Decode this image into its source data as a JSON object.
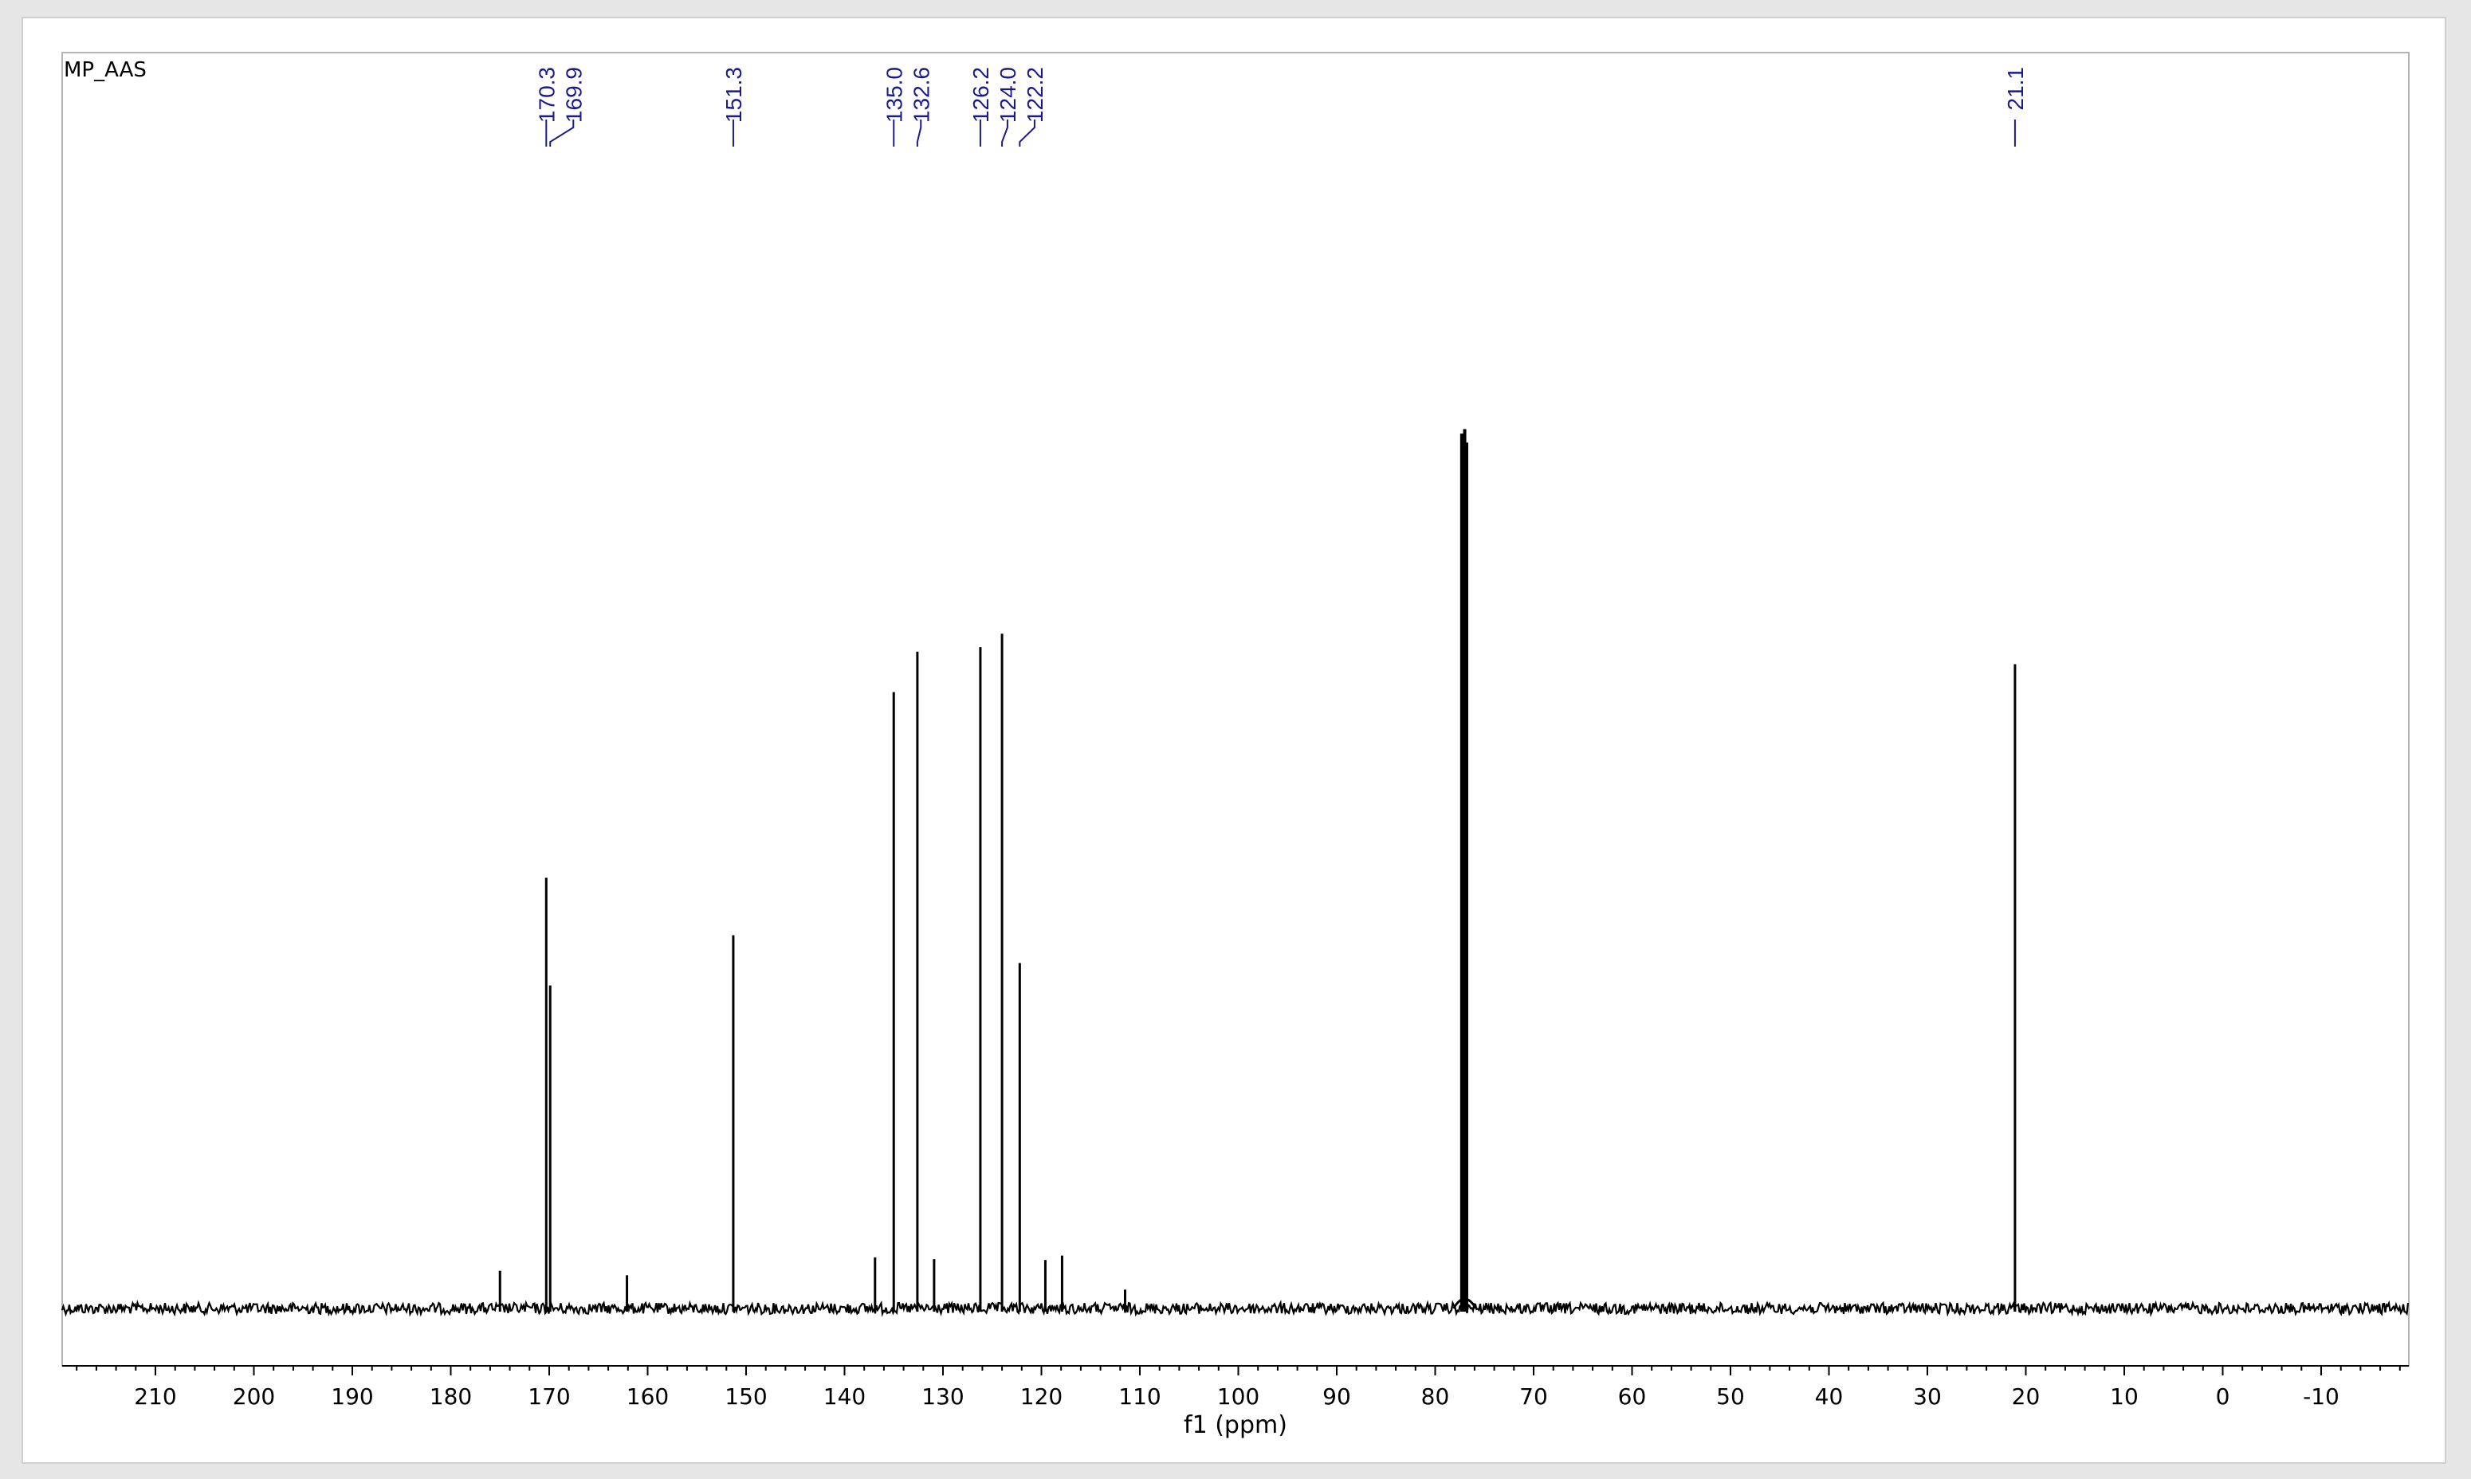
{
  "window": {
    "title": "MP_AAS"
  },
  "chart_data": {
    "type": "line",
    "title": "MP_AAS",
    "xlabel": "f1 (ppm)",
    "ylabel": "",
    "xlim": [
      220,
      -20
    ],
    "x_reversed": true,
    "ylim": [
      0,
      1.0
    ],
    "grid": false,
    "legend": "none",
    "x_ticks": [
      210,
      200,
      190,
      180,
      170,
      160,
      150,
      140,
      130,
      120,
      110,
      100,
      90,
      80,
      70,
      60,
      50,
      40,
      30,
      20,
      10,
      0,
      -10
    ],
    "x_tick_labels": [
      "210",
      "200",
      "190",
      "180",
      "170",
      "160",
      "150",
      "140",
      "130",
      "120",
      "110",
      "100",
      "90",
      "80",
      "70",
      "60",
      "50",
      "40",
      "30",
      "20",
      "10",
      "0",
      "-10"
    ],
    "line_color": "#000000",
    "label_color": "#1a1a8a",
    "peaks": [
      {
        "ppm": 175.0,
        "intensity": 0.042
      },
      {
        "ppm": 170.3,
        "intensity": 0.48
      },
      {
        "ppm": 169.9,
        "intensity": 0.36
      },
      {
        "ppm": 162.1,
        "intensity": 0.037
      },
      {
        "ppm": 151.3,
        "intensity": 0.416
      },
      {
        "ppm": 136.9,
        "intensity": 0.057
      },
      {
        "ppm": 135.0,
        "intensity": 0.687
      },
      {
        "ppm": 132.6,
        "intensity": 0.732
      },
      {
        "ppm": 130.9,
        "intensity": 0.055
      },
      {
        "ppm": 126.2,
        "intensity": 0.737
      },
      {
        "ppm": 124.0,
        "intensity": 0.752
      },
      {
        "ppm": 122.2,
        "intensity": 0.385
      },
      {
        "ppm": 119.6,
        "intensity": 0.054
      },
      {
        "ppm": 117.9,
        "intensity": 0.059
      },
      {
        "ppm": 111.5,
        "intensity": 0.021
      },
      {
        "ppm": 77.3,
        "intensity": 0.975
      },
      {
        "ppm": 77.0,
        "intensity": 0.98
      },
      {
        "ppm": 76.8,
        "intensity": 0.965
      },
      {
        "ppm": 21.1,
        "intensity": 0.718
      }
    ],
    "peak_labels": [
      "170.3",
      "169.9",
      "151.3",
      "135.0",
      "132.6",
      "126.2",
      "124.0",
      "122.2",
      "21.1"
    ],
    "peak_label_positions": [
      170.3,
      169.9,
      151.3,
      135.0,
      132.6,
      126.2,
      124.0,
      122.2,
      21.1
    ]
  }
}
